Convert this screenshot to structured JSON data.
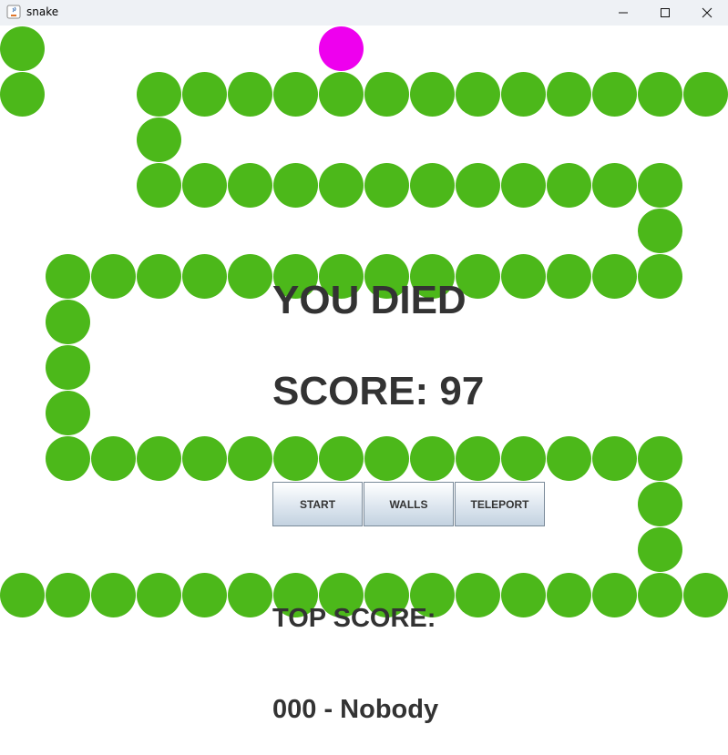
{
  "window": {
    "title": "snake"
  },
  "game": {
    "status": "YOU DIED",
    "score_text": "SCORE: 97",
    "top_score_label": "TOP SCORE:",
    "top_score_value": "000 - Nobody"
  },
  "buttons": {
    "start": "START",
    "walls": "WALLS",
    "teleport": "TELEPORT"
  },
  "colors": {
    "snake": "#4cb81a",
    "food": "#ee00ee",
    "text": "#333333",
    "background": "#ffffff"
  },
  "snake_segments": [
    [
      0,
      0
    ],
    [
      0,
      1
    ],
    [
      3,
      1
    ],
    [
      4,
      1
    ],
    [
      5,
      1
    ],
    [
      6,
      1
    ],
    [
      7,
      1
    ],
    [
      8,
      1
    ],
    [
      9,
      1
    ],
    [
      10,
      1
    ],
    [
      11,
      1
    ],
    [
      12,
      1
    ],
    [
      13,
      1
    ],
    [
      14,
      1
    ],
    [
      15,
      1
    ],
    [
      3,
      2
    ],
    [
      3,
      3
    ],
    [
      4,
      3
    ],
    [
      5,
      3
    ],
    [
      6,
      3
    ],
    [
      7,
      3
    ],
    [
      8,
      3
    ],
    [
      9,
      3
    ],
    [
      10,
      3
    ],
    [
      11,
      3
    ],
    [
      12,
      3
    ],
    [
      13,
      3
    ],
    [
      14,
      3
    ],
    [
      14,
      4
    ],
    [
      1,
      5
    ],
    [
      2,
      5
    ],
    [
      3,
      5
    ],
    [
      4,
      5
    ],
    [
      5,
      5
    ],
    [
      6,
      5
    ],
    [
      7,
      5
    ],
    [
      8,
      5
    ],
    [
      9,
      5
    ],
    [
      10,
      5
    ],
    [
      11,
      5
    ],
    [
      12,
      5
    ],
    [
      13,
      5
    ],
    [
      14,
      5
    ],
    [
      1,
      6
    ],
    [
      1,
      7
    ],
    [
      1,
      8
    ],
    [
      1,
      9
    ],
    [
      2,
      9
    ],
    [
      3,
      9
    ],
    [
      4,
      9
    ],
    [
      5,
      9
    ],
    [
      6,
      9
    ],
    [
      7,
      9
    ],
    [
      8,
      9
    ],
    [
      9,
      9
    ],
    [
      10,
      9
    ],
    [
      11,
      9
    ],
    [
      12,
      9
    ],
    [
      13,
      9
    ],
    [
      14,
      9
    ],
    [
      14,
      10
    ],
    [
      14,
      11
    ],
    [
      0,
      12
    ],
    [
      1,
      12
    ],
    [
      2,
      12
    ],
    [
      3,
      12
    ],
    [
      4,
      12
    ],
    [
      5,
      12
    ],
    [
      6,
      12
    ],
    [
      7,
      12
    ],
    [
      8,
      12
    ],
    [
      9,
      12
    ],
    [
      10,
      12
    ],
    [
      11,
      12
    ],
    [
      12,
      12
    ],
    [
      13,
      12
    ],
    [
      14,
      12
    ],
    [
      15,
      12
    ]
  ],
  "food": [
    7,
    0
  ]
}
